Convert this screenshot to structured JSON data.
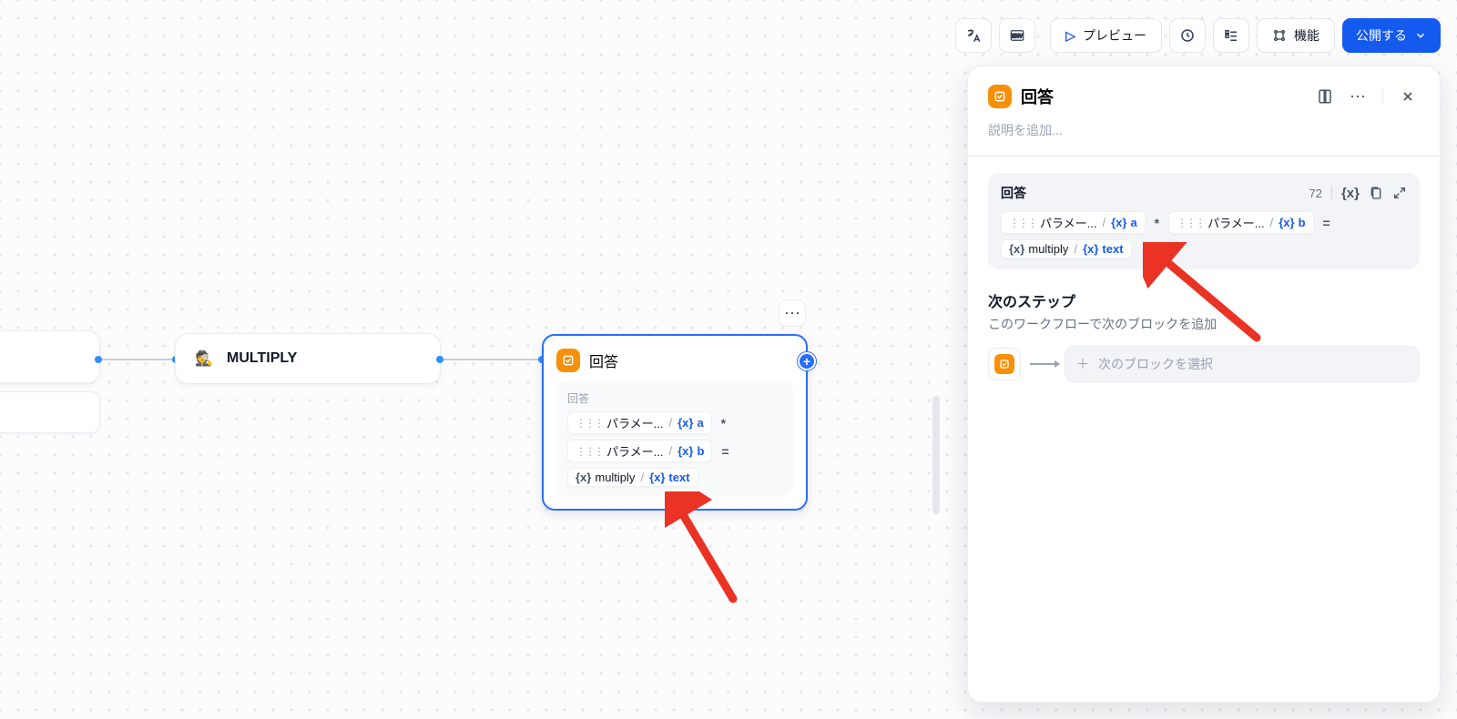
{
  "toolbar": {
    "preview_label": "プレビュー",
    "features_label": "機能",
    "publish_label": "公開する"
  },
  "canvas": {
    "multiply_node_label": "MULTIPLY",
    "answer_node_title": "回答",
    "answer_body_label": "回答",
    "param_label": "パラメー...",
    "var_a": "a",
    "var_b": "b",
    "var_multiply": "multiply",
    "var_text": "text",
    "op_star": "*",
    "op_equals": "="
  },
  "panel": {
    "title": "回答",
    "desc_placeholder": "説明を追加...",
    "answer_label": "回答",
    "answer_count": "72",
    "next_title": "次のステップ",
    "next_sub": "このワークフローで次のブロックを追加",
    "next_select_placeholder": "次のブロックを選択"
  }
}
